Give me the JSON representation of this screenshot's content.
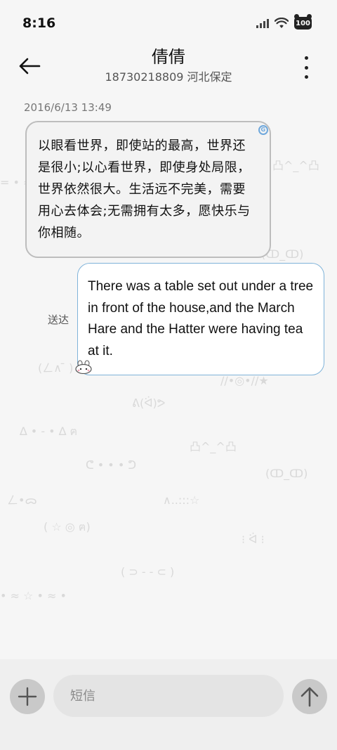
{
  "status_bar": {
    "time": "8:16",
    "battery_level": "100",
    "icons": [
      "signal-icon",
      "wifi-icon",
      "battery-icon"
    ]
  },
  "header": {
    "contact_name": "倩倩",
    "contact_subtitle": "18730218809 河北保定",
    "back_icon": "arrow-left-icon",
    "more_icon": "more-vertical-icon"
  },
  "conversation": {
    "timestamp": "2016/6/13 13:49",
    "messages": [
      {
        "direction": "incoming",
        "text": "以眼看世界，即使站的最高，世界还是很小;以心看世界，即使身处局限，世界依然很大。生活远不完美，需要用心去体会;无需拥有太多，愿快乐与你相随。"
      },
      {
        "direction": "outgoing",
        "text": "There was a table set out under a tree in front of the house,and the March Hare and the Hatter were having tea at it.",
        "status": "送达"
      }
    ]
  },
  "composer": {
    "placeholder": "短信",
    "value": "",
    "add_icon": "plus-icon",
    "send_icon": "arrow-up-icon"
  },
  "colors": {
    "background": "#f6f6f6",
    "incoming_border": "#bdbdbd",
    "outgoing_border": "#7fb3d9",
    "composer_background": "#efefef"
  }
}
